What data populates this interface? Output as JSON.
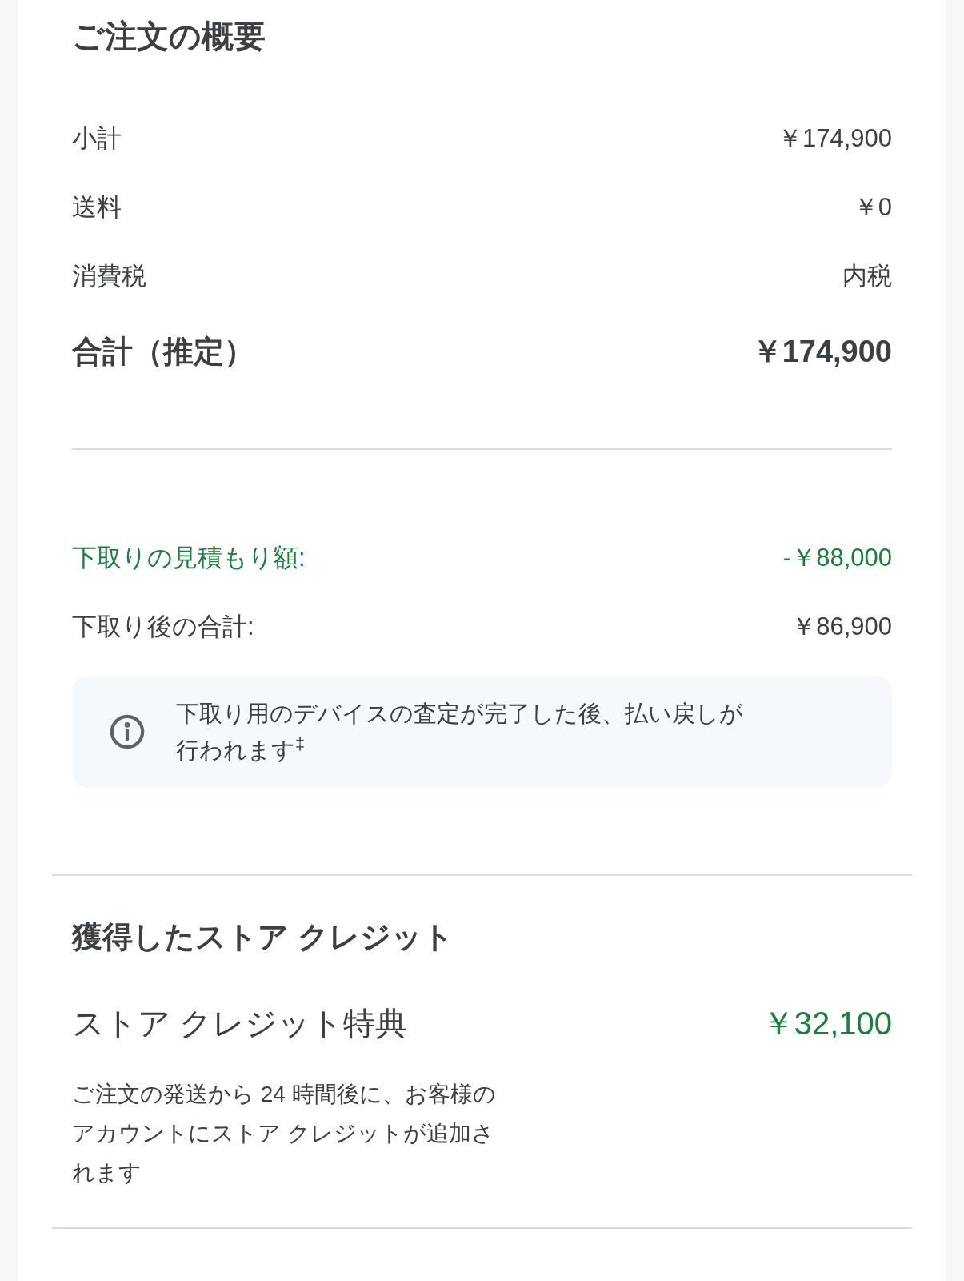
{
  "order_summary": {
    "title": "ご注文の概要",
    "rows": [
      {
        "label": "小計",
        "value": "￥174,900",
        "kind": "normal"
      },
      {
        "label": "送料",
        "value": "￥0",
        "kind": "normal"
      },
      {
        "label": "消費税",
        "value": "内税",
        "kind": "normal"
      },
      {
        "label": "合計（推定）",
        "value": "￥174,900",
        "kind": "total"
      }
    ]
  },
  "trade_in": {
    "rows": [
      {
        "label": "下取りの見積もり額:",
        "value": "-￥88,000",
        "kind": "credit"
      },
      {
        "label": "下取り後の合計:",
        "value": "￥86,900",
        "kind": "normal"
      }
    ],
    "notice": "下取り用のデバイスの査定が完了した後、払い戻しが行われます$^{‡}$"
  },
  "store_credit": {
    "title": "獲得したストア クレジット",
    "perk": {
      "label": "ストア クレジット特典",
      "value": "￥32,100"
    },
    "description": "ご注文の発送から 24 時間後に、お客様のアカウントにストア クレジットが追加されます"
  }
}
